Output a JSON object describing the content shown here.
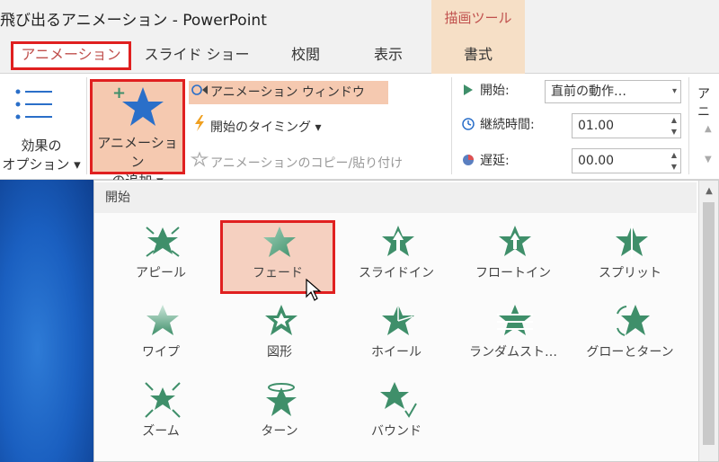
{
  "window": {
    "title": "飛び出るアニメーション - PowerPoint",
    "context_group": "描画ツール"
  },
  "tabs": [
    {
      "label": "アニメーション",
      "active": true
    },
    {
      "label": "スライド ショー"
    },
    {
      "label": "校閲"
    },
    {
      "label": "表示"
    },
    {
      "label": "書式",
      "contextual": true
    }
  ],
  "ribbon": {
    "effect_options": {
      "line1": "効果の",
      "line2": "オプション ▾"
    },
    "add_animation": {
      "line1": "アニメーション",
      "line2": "の追加 ▾"
    },
    "animation_pane": "アニメーション ウィンドウ",
    "trigger": "開始のタイミング ▾",
    "animation_painter": "アニメーションのコピー/貼り付け",
    "start_label": "開始:",
    "start_value": "直前の動作…",
    "duration_label": "継続時間:",
    "duration_value": "01.00",
    "delay_label": "遅延:",
    "delay_value": "00.00",
    "reorder_cut": "アニ"
  },
  "gallery": {
    "section": "開始",
    "items": [
      {
        "label": "アピール",
        "icon": "appear-icon"
      },
      {
        "label": "フェード",
        "icon": "fade-icon",
        "selected": true
      },
      {
        "label": "スライドイン",
        "icon": "fly-in-icon"
      },
      {
        "label": "フロートイン",
        "icon": "float-in-icon"
      },
      {
        "label": "スプリット",
        "icon": "split-icon"
      },
      {
        "label": "ワイプ",
        "icon": "wipe-icon"
      },
      {
        "label": "図形",
        "icon": "shape-icon"
      },
      {
        "label": "ホイール",
        "icon": "wheel-icon"
      },
      {
        "label": "ランダムスト…",
        "icon": "random-bars-icon"
      },
      {
        "label": "グローとターン",
        "icon": "grow-turn-icon"
      },
      {
        "label": "ズーム",
        "icon": "zoom-icon"
      },
      {
        "label": "ターン",
        "icon": "swivel-icon"
      },
      {
        "label": "バウンド",
        "icon": "bounce-icon"
      }
    ]
  },
  "colors": {
    "accent_red": "#e02020",
    "highlight": "#f5c9b0",
    "star_green": "#3f8f6a",
    "star_blue": "#2a6fc9"
  }
}
